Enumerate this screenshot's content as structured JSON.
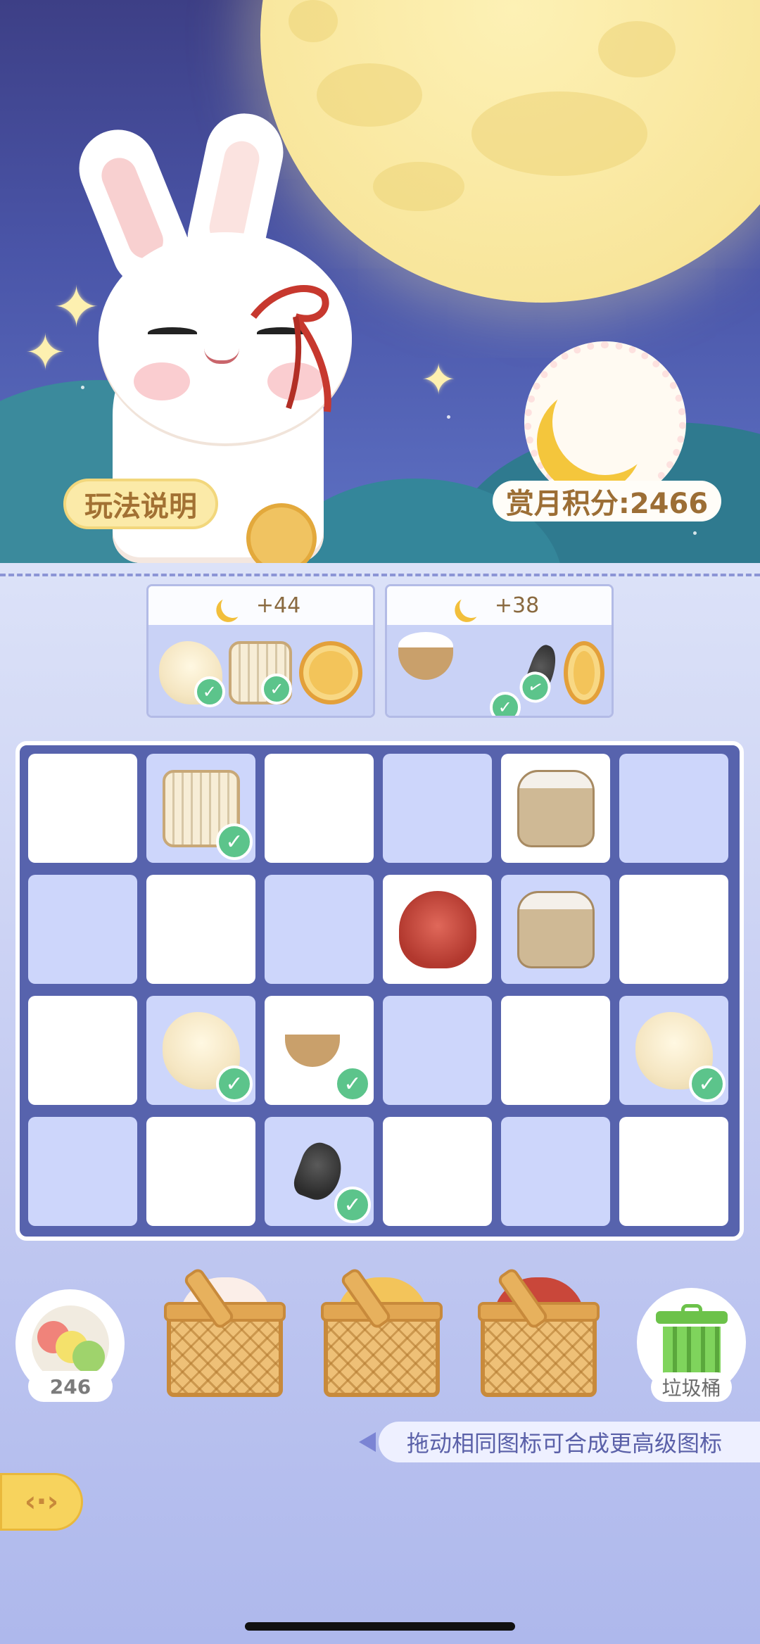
{
  "hero": {
    "help_button": "玩法说明",
    "score_label": "赏月积分:2466"
  },
  "recipes": [
    {
      "points": "+44",
      "ingredients": [
        "cloth-icon",
        "lace-roll-icon",
        "mooncake-icon"
      ],
      "completed": [
        true,
        true,
        false
      ]
    },
    {
      "points": "+38",
      "ingredients": [
        "flour-bowl-icon",
        "shrimp-icon",
        "mooncake-icon"
      ],
      "completed": [
        true,
        true,
        false
      ]
    }
  ],
  "board": {
    "rows": 4,
    "cols": 6,
    "cells": [
      [
        "empty",
        "lace-roll-icon",
        "empty",
        "empty",
        "flour-sack-icon",
        "empty"
      ],
      [
        "empty",
        "empty",
        "empty",
        "crab-icon",
        "flour-sack-icon",
        "empty"
      ],
      [
        "empty",
        "cloth-icon",
        "flour-bowl-icon",
        "empty",
        "empty",
        "cloth-icon"
      ],
      [
        "empty",
        "empty",
        "shrimp-icon",
        "empty",
        "empty",
        "empty"
      ]
    ]
  },
  "bottom": {
    "plate_count": "246",
    "trash_label": "垃圾桶",
    "hint": "拖动相同图标可合成更高级图标"
  },
  "colors": {
    "sky": "#3d3f86",
    "moon": "#f8e59a",
    "check": "#5cc48b",
    "board": "#5763ad"
  }
}
